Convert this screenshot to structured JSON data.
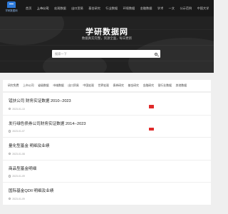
{
  "logo": {
    "text": "学研数据网"
  },
  "topnav": [
    "首页",
    "上市公司",
    "宏观数据",
    "出口贸易",
    "基金研究",
    "行业数据",
    "环境数据",
    "金融数据",
    "学术",
    "一文",
    "公示范例",
    "中国大学"
  ],
  "hero": {
    "title": "学研数据网",
    "subtitle": "数据真实完整，资源全面，每日更新",
    "search_placeholder": "搜索一下"
  },
  "categories": [
    "研究免费",
    "上市公司",
    "省级数据",
    "市域数据",
    "出口贸易",
    "中国宏观",
    "世界宏观",
    "债券研究",
    "基金研究",
    "金融研究",
    "银行业数据",
    "其他数据"
  ],
  "items": [
    {
      "title": "锰扶公司 财务实证数据 2010--2023",
      "date": "2023-01-10"
    },
    {
      "title": "发行绿色债券公司财务实证数据 2014--2023",
      "date": "2023-01-07"
    },
    {
      "title": "量化型基金 明细及业绩",
      "date": "2023-01-08"
    },
    {
      "title": "商品型基金明细",
      "date": "2023-01-09"
    },
    {
      "title": "国际基金QDII 明细及业绩",
      "date": "2023-01-09"
    }
  ],
  "colors": {
    "topbar": "#191919",
    "hero": "#222222",
    "accent": "#e02a2a",
    "logo": "#2e7ad9"
  }
}
